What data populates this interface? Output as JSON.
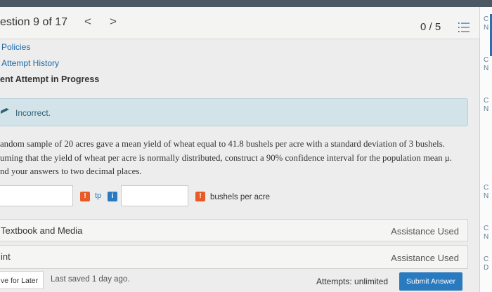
{
  "header": {
    "question_label": "estion 9 of 17",
    "prev_glyph": "<",
    "next_glyph": ">",
    "score": "0 / 5"
  },
  "links": {
    "policies": "Policies",
    "attempt_history": "Attempt History",
    "current_attempt": "ent Attempt in Progress"
  },
  "feedback": {
    "status": "Incorrect."
  },
  "problem": {
    "line1": "andom sample of 20 acres gave a mean yield of wheat equal to 41.8 bushels per acre with a standard deviation of 3 bushels.",
    "line2": "uming that the yield of wheat per acre is normally distributed, construct a 90% confidence interval for the population mean μ.",
    "line3": "nd your answers to two decimal places."
  },
  "answer": {
    "warn_glyph": "!",
    "info_glyph": "i",
    "tp_label": "tp",
    "unit": "bushels per acre"
  },
  "panels": {
    "textbook_title": "Textbook and Media",
    "textbook_status": "Assistance Used",
    "hint_title": "int",
    "hint_status": "Assistance Used"
  },
  "footer": {
    "save_later": "ve for Later",
    "last_saved": "Last saved 1 day ago.",
    "attempts": "Attempts: unlimited",
    "submit": "Submit Answer"
  },
  "rail": {
    "marks": [
      "C",
      "N",
      "C",
      "N",
      "C",
      "N",
      "C",
      "N",
      "C",
      "N",
      "C",
      "D"
    ]
  },
  "colors": {
    "accent": "#2a7ac0",
    "warning": "#e85a26",
    "feedback_bg": "#d2e3ea"
  }
}
